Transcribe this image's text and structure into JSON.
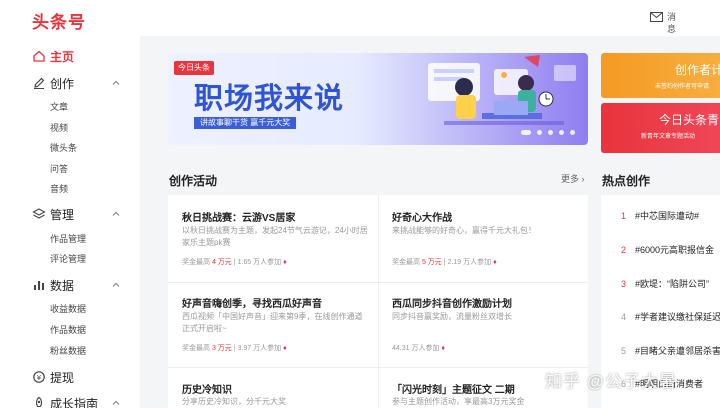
{
  "header": {
    "logo": "头条号",
    "message_label": "消息"
  },
  "sidebar": {
    "home": "主页",
    "create": {
      "label": "创作",
      "items": [
        "文章",
        "视频",
        "微头条",
        "问答",
        "音频"
      ]
    },
    "manage": {
      "label": "管理",
      "items": [
        "作品管理",
        "评论管理"
      ]
    },
    "data": {
      "label": "数据",
      "items": [
        "收益数据",
        "作品数据",
        "粉丝数据"
      ]
    },
    "withdraw": "提现",
    "growth": "成长指南"
  },
  "banner": {
    "tag": "今日头条",
    "title": "职场我来说",
    "subtitle": "讲故事聊干货 赢千元大奖",
    "active_slide": 1,
    "slide_count": 5
  },
  "promos": [
    {
      "title": "创作者计",
      "subtitle": "未签约创作者可申请"
    },
    {
      "title": "今日头条青",
      "subtitle": "新青年文章专题活动"
    }
  ],
  "activity": {
    "title": "创作活动",
    "more": "更多",
    "cards": [
      {
        "title": "秋日挑战赛：云游VS居家",
        "desc": "以秋日挑战赛为主题，发起24节气云游记，24小时居家乐主题pk赛",
        "meta_prefix": "奖金最高",
        "meta_amount": "4 万元",
        "meta_count": "1.65 万人参加"
      },
      {
        "title": "好奇心大作战",
        "desc": "来挑战能够的好奇心，赢得千元大礼包！",
        "meta_prefix": "奖金最高",
        "meta_amount": "5 万元",
        "meta_count": "2.19 万人参加"
      },
      {
        "title": "好声音嗨创季，寻找西瓜好声音",
        "desc": "西瓜视频「中国好声音」迎来第9季，在线创作通道正式开启啦~",
        "meta_prefix": "奖金最高",
        "meta_amount": "3 万元",
        "meta_count": "3.97 万人参加"
      },
      {
        "title": "西瓜同步抖音创作激励计划",
        "desc": "同步抖音赢奖励，流量粉丝双增长",
        "meta_prefix": "",
        "meta_amount": "",
        "meta_count": "44.31 万人参加"
      },
      {
        "title": "历史冷知识",
        "desc": "分享历史冷知识，分千元大奖",
        "meta_prefix": "",
        "meta_amount": "",
        "meta_count": ""
      },
      {
        "title": "「闪光时刻」主题征文 二期",
        "desc": "参与主题创作活动，享最高3万元奖金",
        "meta_prefix": "",
        "meta_amount": "",
        "meta_count": ""
      }
    ]
  },
  "hot": {
    "title": "热点创作",
    "items": [
      {
        "num": "1",
        "text": "#中芯国际遭动#"
      },
      {
        "num": "2",
        "text": "#6000元高职报信金"
      },
      {
        "num": "3",
        "text": "#欧堤：“陷阱公司”"
      },
      {
        "num": "4",
        "text": "#学者建议缴社保延迟"
      },
      {
        "num": "5",
        "text": "#目睹父亲遭邻居杀害"
      },
      {
        "num": "6",
        "text": "#明明白白消费者"
      }
    ]
  },
  "watermark": "知乎 @公子大暑",
  "colors": {
    "accent": "#e8343c",
    "banner_blue": "#2f55d4",
    "promo_orange": "#f59a23"
  }
}
